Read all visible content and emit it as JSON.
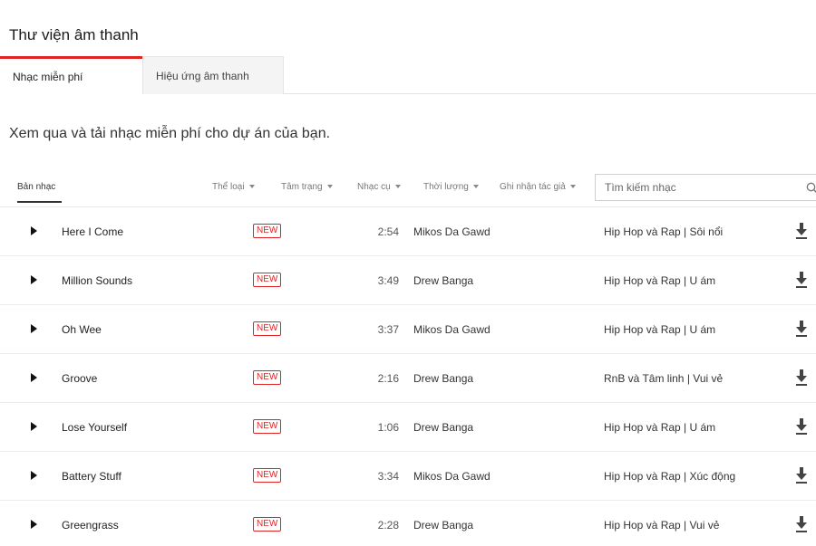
{
  "page_title": "Thư viện âm thanh",
  "tabs": [
    {
      "label": "Nhạc miễn phí",
      "active": true
    },
    {
      "label": "Hiệu ứng âm thanh",
      "active": false
    }
  ],
  "subtitle": "Xem qua và tải nhạc miễn phí cho dự án của bạn.",
  "columns": {
    "track": "Bản nhạc",
    "filters": [
      "Thể loại",
      "Tâm trạng",
      "Nhạc cụ",
      "Thời lượng",
      "Ghi nhận tác giả"
    ]
  },
  "search": {
    "placeholder": "Tìm kiếm nhạc",
    "icon": "search-icon"
  },
  "accent_color": "#e02424",
  "tracks": [
    {
      "title": "Here I Come",
      "badge": "NEW",
      "duration": "2:54",
      "artist": "Mikos Da Gawd",
      "genre": "Hip Hop và Rap | Sôi nổi"
    },
    {
      "title": "Million Sounds",
      "badge": "NEW",
      "duration": "3:49",
      "artist": "Drew Banga",
      "genre": "Hip Hop và Rap | U ám"
    },
    {
      "title": "Oh Wee",
      "badge": "NEW",
      "duration": "3:37",
      "artist": "Mikos Da Gawd",
      "genre": "Hip Hop và Rap | U ám"
    },
    {
      "title": "Groove",
      "badge": "NEW",
      "duration": "2:16",
      "artist": "Drew Banga",
      "genre": "RnB và Tâm linh | Vui vẻ"
    },
    {
      "title": "Lose Yourself",
      "badge": "NEW",
      "duration": "1:06",
      "artist": "Drew Banga",
      "genre": "Hip Hop và Rap | U ám"
    },
    {
      "title": "Battery Stuff",
      "badge": "NEW",
      "duration": "3:34",
      "artist": "Mikos Da Gawd",
      "genre": "Hip Hop và Rap | Xúc động"
    },
    {
      "title": "Greengrass",
      "badge": "NEW",
      "duration": "2:28",
      "artist": "Drew Banga",
      "genre": "Hip Hop và Rap | Vui vẻ"
    }
  ]
}
